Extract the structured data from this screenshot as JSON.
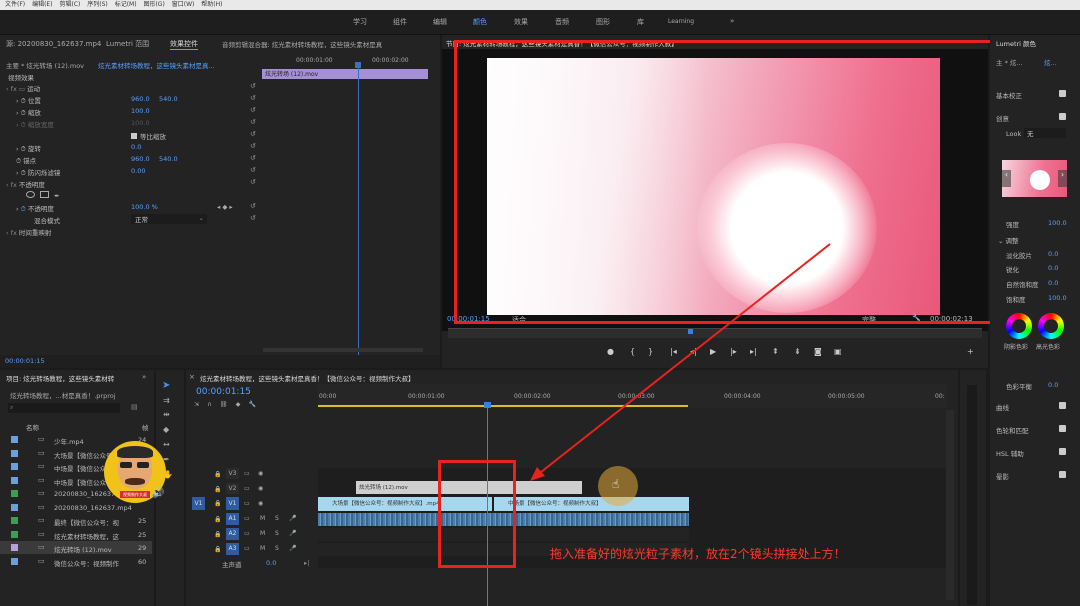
{
  "menubar": [
    "文件(F)",
    "编辑(E)",
    "剪辑(C)",
    "序列(S)",
    "标记(M)",
    "图形(G)",
    "窗口(W)",
    "帮助(H)"
  ],
  "workspaces": [
    {
      "label": "学习",
      "active": false
    },
    {
      "label": "组件",
      "active": false
    },
    {
      "label": "编辑",
      "active": false
    },
    {
      "label": "颜色",
      "active": true
    },
    {
      "label": "效果",
      "active": false
    },
    {
      "label": "音频",
      "active": false
    },
    {
      "label": "图形",
      "active": false
    },
    {
      "label": "库",
      "active": false
    },
    {
      "label": "Learning",
      "active": false
    }
  ],
  "workspaces_more": "»",
  "left_tabs": {
    "source": "源: 20200830_162637.mp4",
    "lumetri_scope": "Lumetri 范围",
    "effect_controls": "效果控件",
    "mixer": "音频剪辑混合器: 炫光素材转场教程，这些镜头素材是真"
  },
  "effect_controls": {
    "clip_path": "主要 * 炫光转场 (12).mov",
    "clip_link": "炫光素材转场教程，这些镜头素材是真...",
    "mini_clip": "炫光转场 (12).mov",
    "mini_times": [
      "00:00:01:00",
      "00:00:02:00"
    ],
    "section": "视频效果",
    "motion": "运动",
    "position": {
      "label": "位置",
      "x": "960.0",
      "y": "540.0"
    },
    "scale": {
      "label": "缩放",
      "v": "100.0"
    },
    "scale_width": {
      "label": "缩放宽度",
      "v": "100.0"
    },
    "uniform": "等比缩放",
    "rotation": {
      "label": "旋转",
      "v": "0.0"
    },
    "anchor": {
      "label": "锚点",
      "x": "960.0",
      "y": "540.0"
    },
    "flicker": {
      "label": "防闪烁滤镜",
      "v": "0.00"
    },
    "opacity_section": "不透明度",
    "opacity": {
      "label": "不透明度",
      "v": "100.0 %"
    },
    "blend": {
      "label": "混合模式",
      "v": "正常"
    },
    "keyframe_ctrl": "◂ ◆ ▸",
    "timeremap": "时间重映射",
    "timecode": "00:00:01:15"
  },
  "program": {
    "title": "节目: 炫光素材转场教程，这些镜头素材是真香！【微信公众号：视频制作大叔】",
    "timecode": "00:00:01:15",
    "fit": "适合",
    "quality": "完整",
    "duration": "00:00:02:13"
  },
  "project": {
    "title": "项目: 炫光转场教程，这些镜头素材转",
    "subtitle": "炫光转场教程，...材是真香！.prproj",
    "col_name": "名称",
    "col_rate": "帧",
    "items": [
      {
        "name": "少年.mp4",
        "rate": "24",
        "color": "#6aa0e0"
      },
      {
        "name": "大场景【微信公众号",
        "rate": "",
        "color": "#6aa0e0"
      },
      {
        "name": "中场景【微信公众号",
        "rate": "",
        "color": "#6aa0e0"
      },
      {
        "name": "中场景【微信公众号",
        "rate": "",
        "color": "#6aa0e0"
      },
      {
        "name": "20200830_162637",
        "rate": "",
        "color": "#3aa050"
      },
      {
        "name": "20200830_162637.mp4",
        "rate": "",
        "color": "#6aa0e0"
      },
      {
        "name": "最终【微信公众号：视",
        "rate": "25",
        "color": "#3aa050"
      },
      {
        "name": "炫光素材转场教程，这",
        "rate": "25",
        "color": "#3aa050"
      },
      {
        "name": "炫光转场 (12).mov",
        "rate": "29",
        "color": "#b8a0e0"
      },
      {
        "name": "微信公众号：视频制作",
        "rate": "60",
        "color": "#6aa0e0"
      }
    ]
  },
  "timeline": {
    "title": "炫光素材转场教程，这些镜头素材是真香！【微信公众号：视频制作大叔】",
    "timecode": "00:00:01:15",
    "ruler": [
      "00:00",
      "00:00:01:00",
      "00:00:02:00",
      "00:00:03:00",
      "00:00:04:00",
      "00:00:05:00",
      "00:"
    ],
    "tracks_v": [
      "V3",
      "V2",
      "V1"
    ],
    "tracks_a": [
      "A1",
      "A2",
      "A3"
    ],
    "master": "主声道",
    "master_val": "0.0",
    "clip_v2": "炫光转场 (12).mov",
    "clip_v1a": "大场景【微信公众号：视频制作大叔】.mp4",
    "clip_v1b": "中场景【微信公众号：视频制作大叔】",
    "annotation": "拖入准备好的炫光粒子素材，放在2个镜头拼接处上方！"
  },
  "lumetri": {
    "tab": "Lumetri 颜色",
    "master": "主 * 炫...",
    "link": "炫...",
    "basic": "基本校正",
    "creative": "创意",
    "look_label": "Look",
    "look_val": "无",
    "intensity": {
      "label": "强度",
      "v": "100.0"
    },
    "adjust": "调整",
    "fade": {
      "label": "淡化胶片",
      "v": "0.0"
    },
    "sharpen": {
      "label": "锐化",
      "v": "0.0"
    },
    "vibrance": {
      "label": "自然饱和度",
      "v": "0.0"
    },
    "saturation": {
      "label": "饱和度",
      "v": "100.0"
    },
    "shadow_tint": "阴影色彩",
    "highlight_tint": "高光色彩",
    "balance": {
      "label": "色彩平衡",
      "v": "0.0"
    },
    "curves": "曲线",
    "wheels": "色轮和匹配",
    "hsl": "HSL 辅助",
    "vignette": "晕影"
  },
  "avatar_label": "视频制作大叔"
}
